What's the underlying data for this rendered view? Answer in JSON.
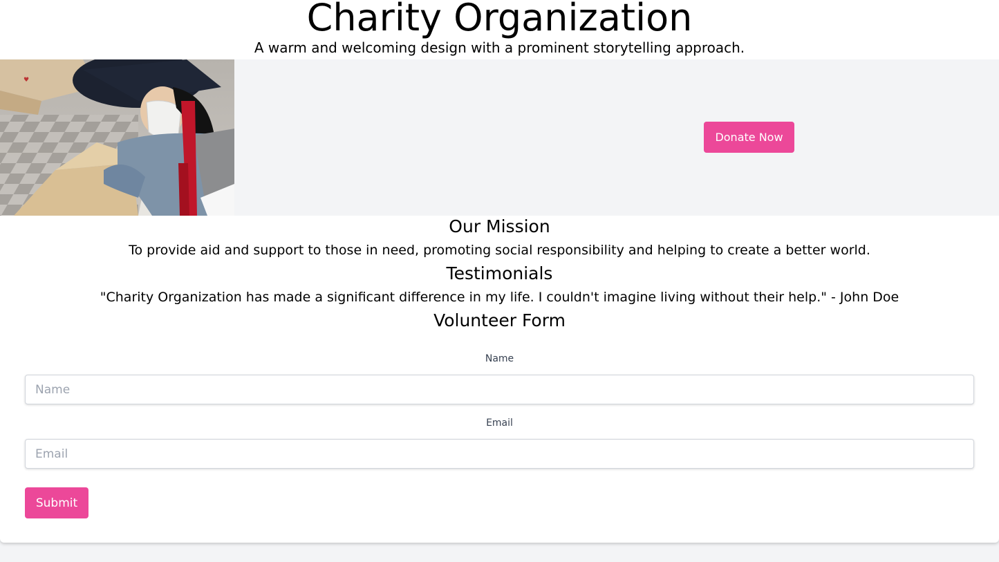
{
  "header": {
    "title": "Charity Organization",
    "tagline": "A warm and welcoming design with a prominent storytelling approach."
  },
  "hero": {
    "photo_description_icon": "volunteer-packing-photo",
    "donate_label": "Donate Now"
  },
  "mission": {
    "heading": "Our Mission",
    "text": "To provide aid and support to those in need, promoting social responsibility and helping to create a better world."
  },
  "testimonials": {
    "heading": "Testimonials",
    "quote": "\"Charity Organization has made a significant difference in my life. I couldn't imagine living without their help.\" - John Doe"
  },
  "volunteer_form": {
    "heading": "Volunteer Form",
    "name_label": "Name",
    "name_placeholder": "Name",
    "name_value": "",
    "email_label": "Email",
    "email_placeholder": "Email",
    "email_value": "",
    "submit_label": "Submit"
  },
  "colors": {
    "accent": "#ec4899",
    "page_background": "#f3f4f6",
    "card_background": "#ffffff"
  }
}
